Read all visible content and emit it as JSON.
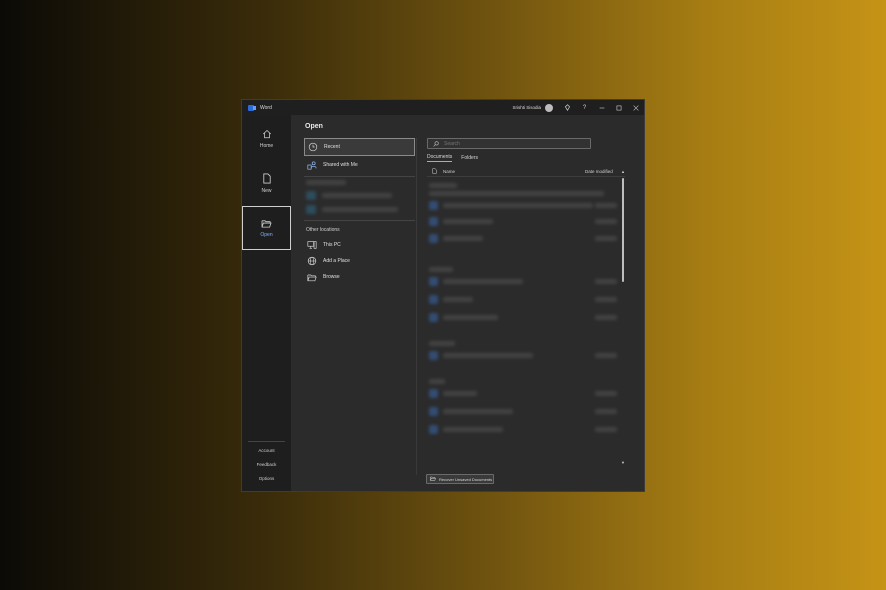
{
  "window": {
    "app_name": "Word",
    "user_name": "Srishti Sisodia"
  },
  "titlebar": {
    "icons": [
      "diamond-icon",
      "help-icon",
      "minimize-icon",
      "maximize-icon",
      "close-icon"
    ]
  },
  "nav": {
    "home": "Home",
    "new": "New",
    "open": "Open",
    "account": "Account",
    "feedback": "Feedback",
    "options": "Options"
  },
  "main": {
    "title": "Open",
    "locations": {
      "recent": "Recent",
      "shared": "Shared with Me",
      "other_heading": "Other locations",
      "this_pc": "This PC",
      "add_place": "Add a Place",
      "browse": "Browse"
    },
    "search": {
      "placeholder": "Search"
    },
    "tabs": {
      "documents": "Documents",
      "folders": "Folders"
    },
    "table": {
      "name_header": "Name",
      "date_header": "Date modified"
    },
    "recover_button": "Recover Unsaved Documents"
  },
  "colors": {
    "accent": "#7fb2ff",
    "word_blue": "#2b6cdb"
  }
}
